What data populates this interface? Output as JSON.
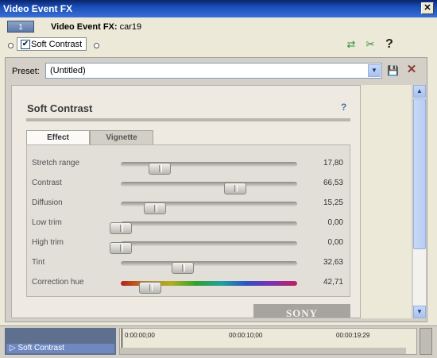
{
  "window": {
    "title": "Video Event FX",
    "close_icon": "close-icon"
  },
  "chain": {
    "number": "1",
    "label": "Video Event FX:",
    "value": "car19"
  },
  "plugin": {
    "name": "Soft Contrast",
    "checked": true,
    "tools": [
      "plugin-chain-icon",
      "remove-plugin-icon",
      "help-icon"
    ]
  },
  "preset": {
    "label": "Preset:",
    "value": "(Untitled)"
  },
  "ui": {
    "heading": "Soft Contrast",
    "help": "?",
    "tabs": [
      "Effect",
      "Vignette"
    ],
    "active_tab": "Effect",
    "brand": "SONY"
  },
  "sliders": [
    {
      "label": "Stretch range",
      "value": "17,80",
      "level": 0.18
    },
    {
      "label": "Contrast",
      "value": "66,53",
      "level": 0.67
    },
    {
      "label": "Diffusion",
      "value": "15,25",
      "level": 0.15
    },
    {
      "label": "Low trim",
      "value": "0,00",
      "level": 0.0
    },
    {
      "label": "High trim",
      "value": "0,00",
      "level": 0.0
    },
    {
      "label": "Tint",
      "value": "32,63",
      "level": 0.33
    },
    {
      "label": "Correction hue",
      "value": "42,71",
      "level": 0.12
    }
  ],
  "timeline": {
    "track": "Soft Contrast",
    "timecodes": [
      "0:00:00;00",
      "00:00:10;00",
      "00:00:19;29"
    ]
  }
}
